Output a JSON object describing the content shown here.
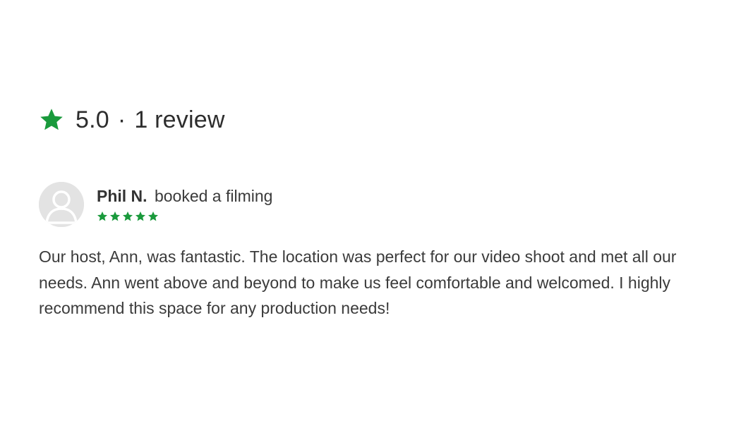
{
  "summary": {
    "rating": "5.0",
    "separator": "·",
    "review_count": "1 review",
    "icon": "star-icon",
    "accent_color": "#1a9a3c"
  },
  "review": {
    "reviewer_name": "Phil N.",
    "action_text": "booked a filming",
    "avatar_icon": "user-avatar-icon",
    "star_rating": 5,
    "body": "Our host, Ann, was fantastic. The location was perfect for our video shoot and met all our needs. Ann went above and beyond to make us feel comfortable and welcomed. I highly recommend this space for any production needs!"
  }
}
